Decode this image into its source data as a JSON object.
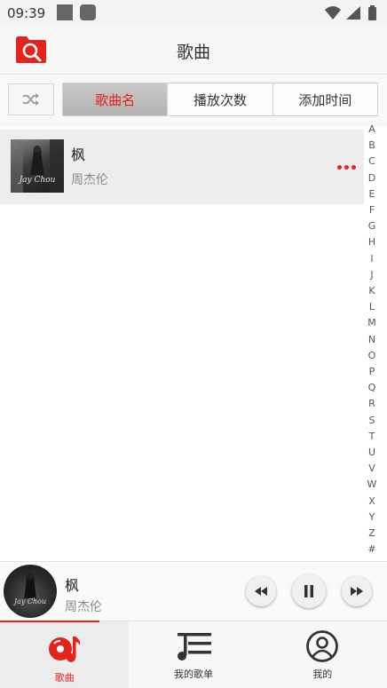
{
  "status_bar": {
    "time": "09:39"
  },
  "header": {
    "title": "歌曲"
  },
  "sort_tabs": [
    {
      "label": "歌曲名",
      "active": true
    },
    {
      "label": "播放次数",
      "active": false
    },
    {
      "label": "添加时间",
      "active": false
    }
  ],
  "songs": [
    {
      "title": "枫",
      "artist": "周杰伦",
      "cover_text": "Jay Chou"
    }
  ],
  "alphabet_index": [
    "A",
    "B",
    "C",
    "D",
    "E",
    "F",
    "G",
    "H",
    "I",
    "J",
    "K",
    "L",
    "M",
    "N",
    "O",
    "P",
    "Q",
    "R",
    "S",
    "T",
    "U",
    "V",
    "W",
    "X",
    "Y",
    "Z",
    "#"
  ],
  "mini_player": {
    "title": "枫",
    "artist": "周杰伦",
    "cover_text": "Jay Chou",
    "state": "playing"
  },
  "bottom_nav": [
    {
      "label": "歌曲",
      "icon": "music-disc-icon",
      "active": true
    },
    {
      "label": "我的歌单",
      "icon": "playlist-icon",
      "active": false
    },
    {
      "label": "我的",
      "icon": "profile-icon",
      "active": false
    }
  ],
  "colors": {
    "accent": "#e3231c",
    "header_bg": "#f6f6f6",
    "row_highlight": "#ededed",
    "active_tab_bg": "#b8b8b8"
  }
}
